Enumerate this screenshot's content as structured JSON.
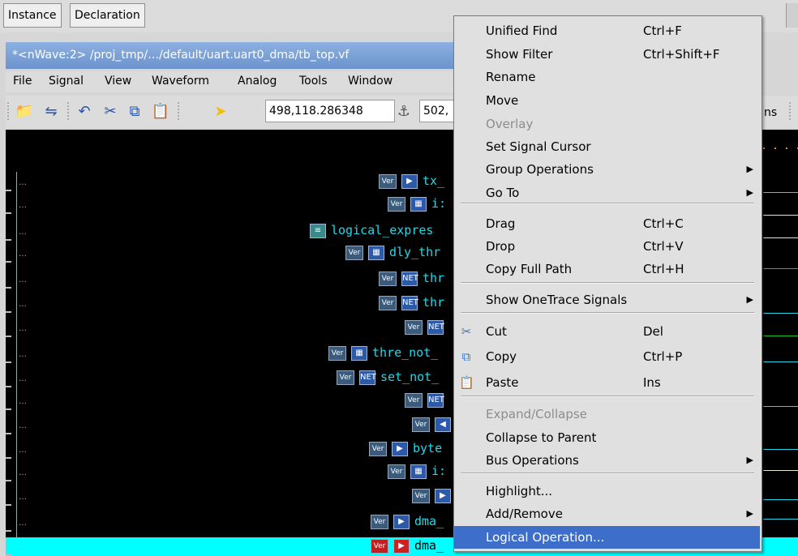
{
  "tabs": [
    "Instance",
    "Declaration"
  ],
  "window": {
    "title": "*<nWave:2> /proj_tmp/…/default/uart.uart0_dma/tb_top.vf"
  },
  "menubar": [
    "File",
    "Signal",
    "View",
    "Waveform",
    "Analog",
    "Tools",
    "Window"
  ],
  "toolbar": {
    "cursor_time": "498,118.286348",
    "marker_time": "502,",
    "units_fragment": "ns"
  },
  "signals": [
    {
      "tag": "Ver",
      "icon": "port-in-icon",
      "name": "tx_"
    },
    {
      "tag": "Ver",
      "icon": "reg-icon",
      "name": "i:"
    },
    {
      "tag": "",
      "icon": "expr-icon",
      "name": "logical_expres"
    },
    {
      "tag": "Ver",
      "icon": "reg-icon",
      "name": "dly_thr"
    },
    {
      "tag": "Ver",
      "icon": "net-icon",
      "name": "thr"
    },
    {
      "tag": "Ver",
      "icon": "net-icon",
      "name": "thr"
    },
    {
      "tag": "Ver",
      "icon": "net-icon",
      "name": ""
    },
    {
      "tag": "Ver",
      "icon": "reg-icon",
      "name": "thre_not_"
    },
    {
      "tag": "Ver",
      "icon": "net-icon",
      "name": "set_not_"
    },
    {
      "tag": "Ver",
      "icon": "net-icon",
      "name": ""
    },
    {
      "tag": "Ver",
      "icon": "port-out-icon",
      "name": ""
    },
    {
      "tag": "Ver",
      "icon": "port-in-icon",
      "name": "byte"
    },
    {
      "tag": "Ver",
      "icon": "reg-icon",
      "name": "i:"
    },
    {
      "tag": "Ver",
      "icon": "port-in-icon",
      "name": ""
    },
    {
      "tag": "Ver",
      "icon": "port-in-icon",
      "name": "dma_"
    },
    {
      "tag": "Ver",
      "icon": "port-in-red-icon",
      "name": "dma_"
    }
  ],
  "context_menu": {
    "items": [
      {
        "label": "Unified Find",
        "shortcut": "Ctrl+F"
      },
      {
        "label": "Show Filter",
        "shortcut": "Ctrl+Shift+F"
      },
      {
        "label": "Rename",
        "shortcut": ""
      },
      {
        "label": "Move",
        "shortcut": ""
      },
      {
        "label": "Overlay",
        "shortcut": "",
        "disabled": true
      },
      {
        "label": "Set Signal Cursor",
        "shortcut": ""
      },
      {
        "label": "Group Operations",
        "shortcut": "",
        "submenu": true
      },
      {
        "label": "Go To",
        "shortcut": "",
        "submenu": true
      },
      {
        "label": "Drag",
        "shortcut": "Ctrl+C"
      },
      {
        "label": "Drop",
        "shortcut": "Ctrl+V"
      },
      {
        "label": "Copy Full Path",
        "shortcut": "Ctrl+H"
      },
      {
        "label": "Show OneTrace Signals",
        "shortcut": "",
        "submenu": true
      },
      {
        "label": "Cut",
        "shortcut": "Del",
        "icon": "scissors-icon"
      },
      {
        "label": "Copy",
        "shortcut": "Ctrl+P",
        "icon": "copy-icon"
      },
      {
        "label": "Paste",
        "shortcut": "Ins",
        "icon": "paste-icon"
      },
      {
        "label": "Expand/Collapse",
        "shortcut": "",
        "disabled": true
      },
      {
        "label": "Collapse to Parent",
        "shortcut": ""
      },
      {
        "label": "Bus Operations",
        "shortcut": "",
        "submenu": true
      },
      {
        "label": "Highlight...",
        "shortcut": ""
      },
      {
        "label": "Add/Remove",
        "shortcut": "",
        "submenu": true
      },
      {
        "label": "Logical Operation...",
        "shortcut": "",
        "selected": true
      }
    ]
  },
  "colors": {
    "signal_text": "#20d8e8",
    "selection": "#3d6ec9",
    "highlight_row": "#00ffff",
    "title_bar": "#7aa0d8"
  }
}
